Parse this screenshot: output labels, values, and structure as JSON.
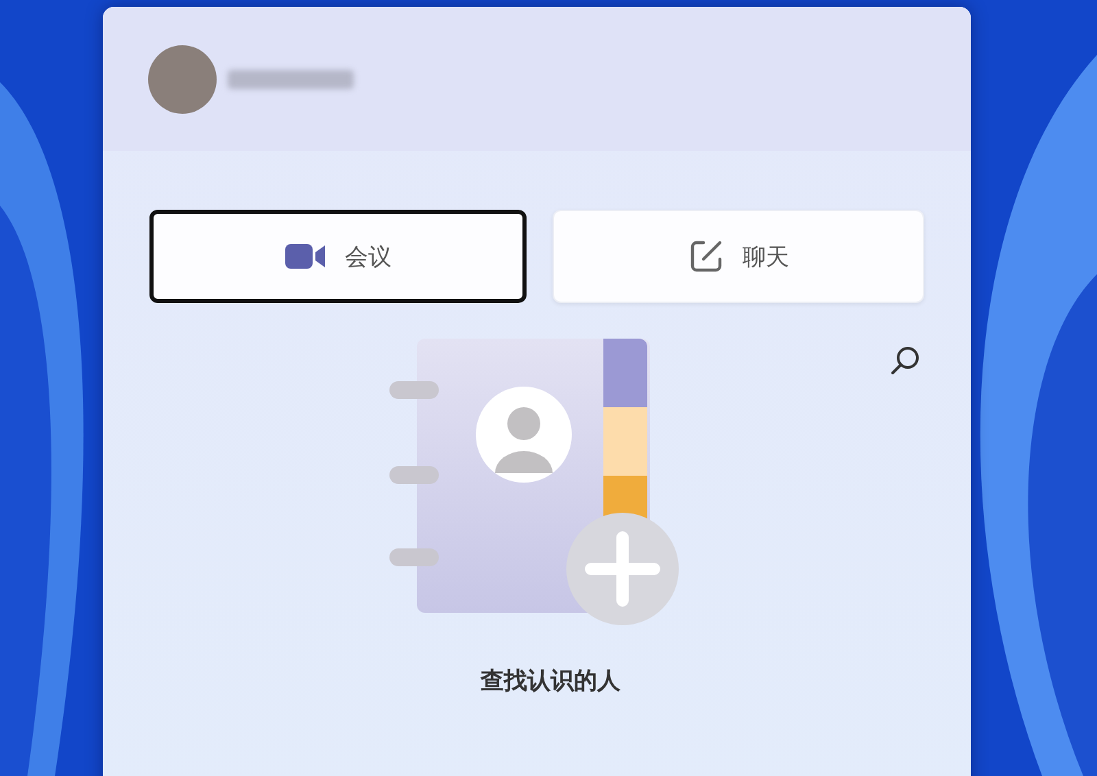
{
  "buttons": [
    {
      "kind": "meeting",
      "label": "会议",
      "focused": true
    },
    {
      "kind": "chat",
      "label": "聊天",
      "focused": false
    }
  ],
  "empty_state": {
    "title": "查找认识的人"
  }
}
